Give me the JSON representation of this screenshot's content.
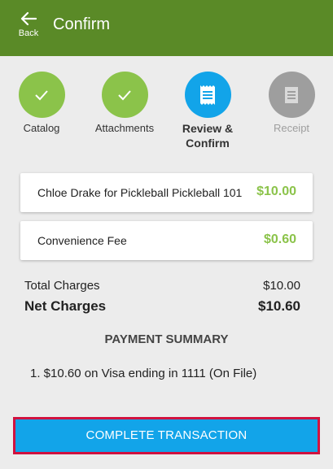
{
  "header": {
    "back_label": "Back",
    "title": "Confirm",
    "color": "#5a8a27"
  },
  "steps": [
    {
      "label": "Catalog",
      "state": "done",
      "icon": "check-icon"
    },
    {
      "label": "Attachments",
      "state": "done",
      "icon": "check-icon"
    },
    {
      "label": "Review & Confirm",
      "state": "active",
      "icon": "receipt-icon"
    },
    {
      "label": "Receipt",
      "state": "inactive",
      "icon": "receipt-icon"
    }
  ],
  "line_items": [
    {
      "description": "Chloe Drake for Pickleball Pickleball 101",
      "amount": "$10.00"
    },
    {
      "description": "Convenience Fee",
      "amount": "$0.60"
    }
  ],
  "totals": {
    "total_label": "Total Charges",
    "total_value": "$10.00",
    "net_label": "Net Charges",
    "net_value": "$10.60"
  },
  "payment_summary": {
    "title": "PAYMENT SUMMARY",
    "lines": [
      "1. $10.60 on Visa ending in 1111 (On File)"
    ]
  },
  "complete_button": {
    "label": "COMPLETE TRANSACTION",
    "color": "#12a4e9",
    "border_color": "#d1123f"
  }
}
